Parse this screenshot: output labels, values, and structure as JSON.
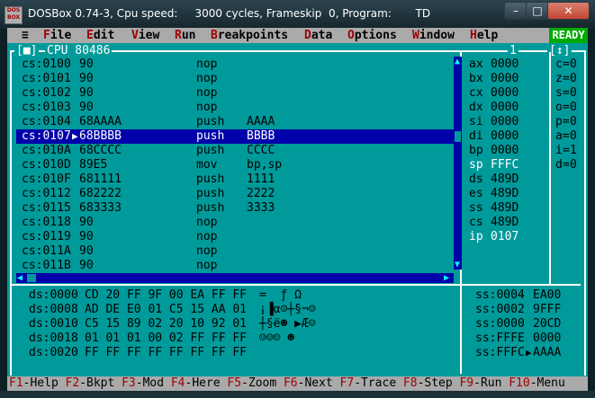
{
  "window": {
    "title": "DOSBox 0.74-3, Cpu speed:     3000 cycles, Frameskip  0, Program:       TD",
    "icon": "dosbox-icon",
    "icon_text": [
      "DOS",
      "BOX"
    ],
    "minimize": "–",
    "maximize": "□",
    "close": "✕"
  },
  "menubar": {
    "system": "≡",
    "items": [
      {
        "hk": "F",
        "rest": "ile"
      },
      {
        "hk": "E",
        "rest": "dit"
      },
      {
        "hk": "V",
        "rest": "iew"
      },
      {
        "hk": "R",
        "rest": "un"
      },
      {
        "hk": "B",
        "rest": "reakpoints"
      },
      {
        "hk": "D",
        "rest": "ata"
      },
      {
        "hk": "O",
        "rest": "ptions"
      },
      {
        "hk": "W",
        "rest": "indow"
      },
      {
        "hk": "H",
        "rest": "elp"
      }
    ],
    "status": "READY"
  },
  "cpu_window": {
    "close_box": "[■]",
    "title": "CPU 80486",
    "number": "1",
    "resize": "[↕]",
    "instructions": [
      {
        "addr": "cs:0100",
        "bytes": "90",
        "mnem": "nop",
        "ops": ""
      },
      {
        "addr": "cs:0101",
        "bytes": "90",
        "mnem": "nop",
        "ops": ""
      },
      {
        "addr": "cs:0102",
        "bytes": "90",
        "mnem": "nop",
        "ops": ""
      },
      {
        "addr": "cs:0103",
        "bytes": "90",
        "mnem": "nop",
        "ops": ""
      },
      {
        "addr": "cs:0104",
        "bytes": "68AAAA",
        "mnem": "push",
        "ops": "AAAA"
      },
      {
        "addr": "cs:0107",
        "bytes": "68BBBB",
        "mnem": "push",
        "ops": "BBBB",
        "current": true
      },
      {
        "addr": "cs:010A",
        "bytes": "68CCCC",
        "mnem": "push",
        "ops": "CCCC"
      },
      {
        "addr": "cs:010D",
        "bytes": "89E5",
        "mnem": "mov",
        "ops": "bp,sp"
      },
      {
        "addr": "cs:010F",
        "bytes": "681111",
        "mnem": "push",
        "ops": "1111"
      },
      {
        "addr": "cs:0112",
        "bytes": "682222",
        "mnem": "push",
        "ops": "2222"
      },
      {
        "addr": "cs:0115",
        "bytes": "683333",
        "mnem": "push",
        "ops": "3333"
      },
      {
        "addr": "cs:0118",
        "bytes": "90",
        "mnem": "nop",
        "ops": ""
      },
      {
        "addr": "cs:0119",
        "bytes": "90",
        "mnem": "nop",
        "ops": ""
      },
      {
        "addr": "cs:011A",
        "bytes": "90",
        "mnem": "nop",
        "ops": ""
      },
      {
        "addr": "cs:011B",
        "bytes": "90",
        "mnem": "nop",
        "ops": ""
      }
    ],
    "ip_marker": "▶",
    "registers": [
      {
        "name": "ax",
        "value": "0000"
      },
      {
        "name": "bx",
        "value": "0000"
      },
      {
        "name": "cx",
        "value": "0000"
      },
      {
        "name": "dx",
        "value": "0000"
      },
      {
        "name": "si",
        "value": "0000"
      },
      {
        "name": "di",
        "value": "0000"
      },
      {
        "name": "bp",
        "value": "0000"
      },
      {
        "name": "sp",
        "value": "FFFC",
        "changed": true
      },
      {
        "name": "ds",
        "value": "489D"
      },
      {
        "name": "es",
        "value": "489D"
      },
      {
        "name": "ss",
        "value": "489D"
      },
      {
        "name": "cs",
        "value": "489D"
      },
      {
        "name": "ip",
        "value": "0107",
        "changed": true
      }
    ],
    "flags": [
      {
        "name": "c",
        "value": "0"
      },
      {
        "name": "z",
        "value": "0"
      },
      {
        "name": "s",
        "value": "0"
      },
      {
        "name": "o",
        "value": "0"
      },
      {
        "name": "p",
        "value": "0"
      },
      {
        "name": "a",
        "value": "0"
      },
      {
        "name": "i",
        "value": "1"
      },
      {
        "name": "d",
        "value": "0"
      }
    ],
    "dump": [
      {
        "addr": "ds:0000",
        "bytes": "CD 20 FF 9F 00 EA FF FF",
        "ascii": "=  ƒ Ω"
      },
      {
        "addr": "ds:0008",
        "bytes": "AD DE E0 01 C5 15 AA 01",
        "ascii": "¡▐α☺┼§¬☺"
      },
      {
        "addr": "ds:0010",
        "bytes": "C5 15 89 02 20 10 92 01",
        "ascii": "┼§ë☻ ▶Æ☺"
      },
      {
        "addr": "ds:0018",
        "bytes": "01 01 01 00 02 FF FF FF",
        "ascii": "☺☺☺ ☻"
      },
      {
        "addr": "ds:0020",
        "bytes": "FF FF FF FF FF FF FF FF",
        "ascii": ""
      }
    ],
    "stack": [
      {
        "addr": "ss:0004",
        "value": "EA00",
        "marker": " "
      },
      {
        "addr": "ss:0002",
        "value": "9FFF",
        "marker": " "
      },
      {
        "addr": "ss:0000",
        "value": "20CD",
        "marker": " "
      },
      {
        "addr": "ss:FFFE",
        "value": "0000",
        "marker": " "
      },
      {
        "addr": "ss:FFFC",
        "value": "AAAA",
        "marker": "▶"
      }
    ]
  },
  "status_keys": [
    {
      "key": "F1",
      "label": "Help"
    },
    {
      "key": "F2",
      "label": "Bkpt"
    },
    {
      "key": "F3",
      "label": "Mod"
    },
    {
      "key": "F4",
      "label": "Here"
    },
    {
      "key": "F5",
      "label": "Zoom"
    },
    {
      "key": "F6",
      "label": "Next"
    },
    {
      "key": "F7",
      "label": "Trace"
    },
    {
      "key": "F8",
      "label": "Step"
    },
    {
      "key": "F9",
      "label": "Run"
    },
    {
      "key": "F10",
      "label": "Menu"
    }
  ],
  "colors": {
    "background": "#009a9a",
    "highlight": "#0000aa",
    "menu": "#aaaaaa",
    "hotkey": "#a00000",
    "ready": "#00aa00",
    "changed": "#ffffff"
  }
}
